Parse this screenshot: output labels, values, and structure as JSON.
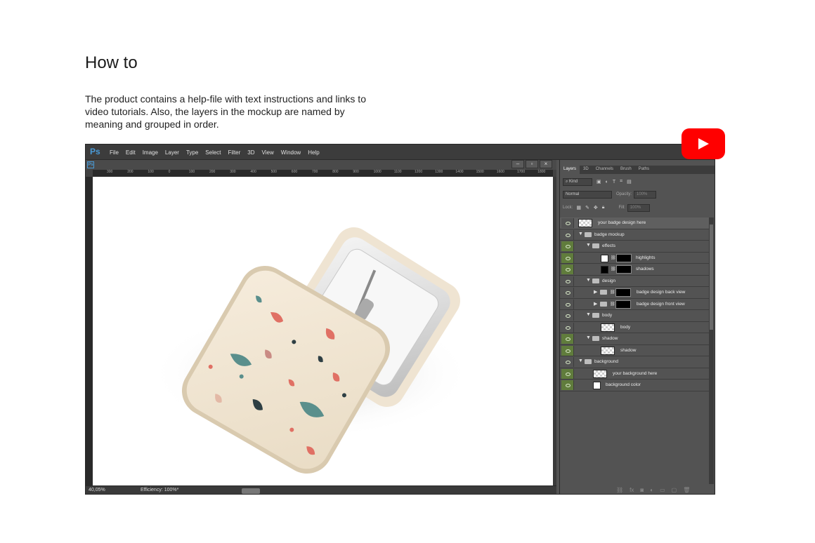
{
  "page": {
    "title": "How to",
    "description": "The product contains a help-file with text instructions and links to video tutorials. Also, the layers in the mockup are named by meaning and grouped in order."
  },
  "app": {
    "logo": "Ps",
    "menu": [
      "File",
      "Edit",
      "Image",
      "Layer",
      "Type",
      "Select",
      "Filter",
      "3D",
      "View",
      "Window",
      "Help"
    ],
    "doc_icon": "Ps",
    "window_buttons": [
      "–",
      "▫",
      "×"
    ],
    "ruler_ticks": [
      "300",
      "200",
      "100",
      "0",
      "100",
      "200",
      "300",
      "400",
      "500",
      "600",
      "700",
      "800",
      "900",
      "1000",
      "1100",
      "1200",
      "1300",
      "1400",
      "1500",
      "1600",
      "1700",
      "1800"
    ],
    "status_zoom": "40,05%",
    "status_efficiency": "Efficiency: 100%*"
  },
  "panel": {
    "tabs": [
      "Layers",
      "3D",
      "Channels",
      "Brush",
      "Paths"
    ],
    "filter_kind": "Kind",
    "blend_mode": "Normal",
    "opacity_label": "Opacity:",
    "opacity_value": "100%",
    "lock_label": "Lock:",
    "fill_label": "Fill:",
    "fill_value": "100%",
    "layers": [
      {
        "name": "your badge design here",
        "indent": 0,
        "type": "smart",
        "visible": false
      },
      {
        "name": "badge mockup",
        "indent": 0,
        "type": "group",
        "visible": false
      },
      {
        "name": "effects",
        "indent": 1,
        "type": "group",
        "visible": true
      },
      {
        "name": "highlights",
        "indent": 2,
        "type": "fill-white",
        "visible": true
      },
      {
        "name": "shadows",
        "indent": 2,
        "type": "fill-black",
        "visible": true
      },
      {
        "name": "design",
        "indent": 1,
        "type": "group",
        "visible": false
      },
      {
        "name": "badge design back view",
        "indent": 2,
        "type": "group-mask",
        "visible": false
      },
      {
        "name": "badge design front view",
        "indent": 2,
        "type": "group-mask",
        "visible": false
      },
      {
        "name": "body",
        "indent": 1,
        "type": "group",
        "visible": false
      },
      {
        "name": "body",
        "indent": 2,
        "type": "pixel",
        "visible": false
      },
      {
        "name": "shadow",
        "indent": 1,
        "type": "group",
        "visible": true
      },
      {
        "name": "shadow",
        "indent": 2,
        "type": "pixel",
        "visible": true
      },
      {
        "name": "background",
        "indent": 0,
        "type": "group",
        "visible": false
      },
      {
        "name": "your background here",
        "indent": 1,
        "type": "pixel",
        "visible": true
      },
      {
        "name": "background color",
        "indent": 1,
        "type": "fill-white",
        "visible": true
      }
    ]
  },
  "icons": {
    "youtube": "youtube-play-icon",
    "colors": {
      "youtube": "#ff0000",
      "ps_blue": "#4a9ad6",
      "eye_green": "#607c3c"
    }
  }
}
